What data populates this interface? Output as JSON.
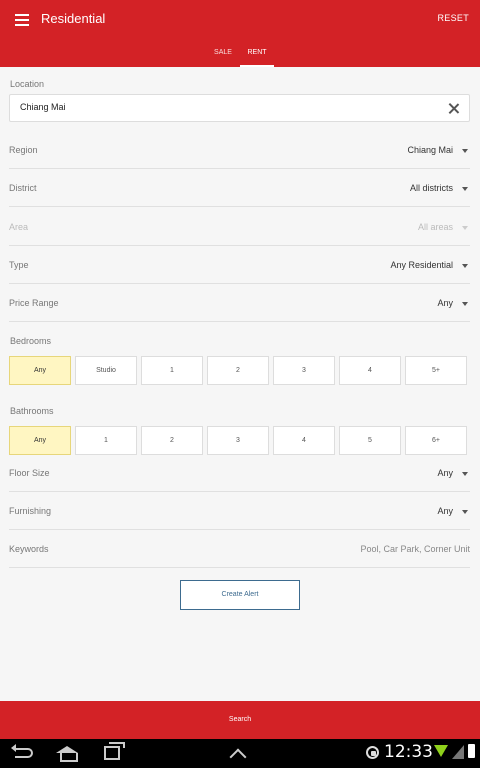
{
  "appbar": {
    "title": "Residential",
    "reset_label": "RESET",
    "tabs": [
      {
        "label": "SALE"
      },
      {
        "label": "RENT"
      }
    ]
  },
  "location": {
    "label": "Location",
    "value": "Chiang Mai"
  },
  "fields": {
    "region": {
      "label": "Region",
      "value": "Chiang Mai"
    },
    "district": {
      "label": "District",
      "value": "All districts"
    },
    "area": {
      "label": "Area",
      "value": "All areas"
    },
    "type": {
      "label": "Type",
      "value": "Any Residential"
    },
    "price_range": {
      "label": "Price Range",
      "value": "Any"
    },
    "floor_size": {
      "label": "Floor Size",
      "value": "Any"
    },
    "furnishing": {
      "label": "Furnishing",
      "value": "Any"
    },
    "keywords": {
      "label": "Keywords",
      "value": "Pool, Car Park, Corner Unit"
    }
  },
  "bedrooms": {
    "label": "Bedrooms",
    "options": [
      "Any",
      "Studio",
      "1",
      "2",
      "3",
      "4",
      "5+"
    ],
    "selected": "Any"
  },
  "bathrooms": {
    "label": "Bathrooms",
    "options": [
      "Any",
      "1",
      "2",
      "3",
      "4",
      "5",
      "6+"
    ],
    "selected": "Any"
  },
  "create_alert_label": "Create Alert",
  "search_label": "Search",
  "status": {
    "time": "12:33"
  },
  "colors": {
    "brand": "#d32226",
    "selected_chip": "#fff6c2",
    "link": "#3d6b8f"
  }
}
